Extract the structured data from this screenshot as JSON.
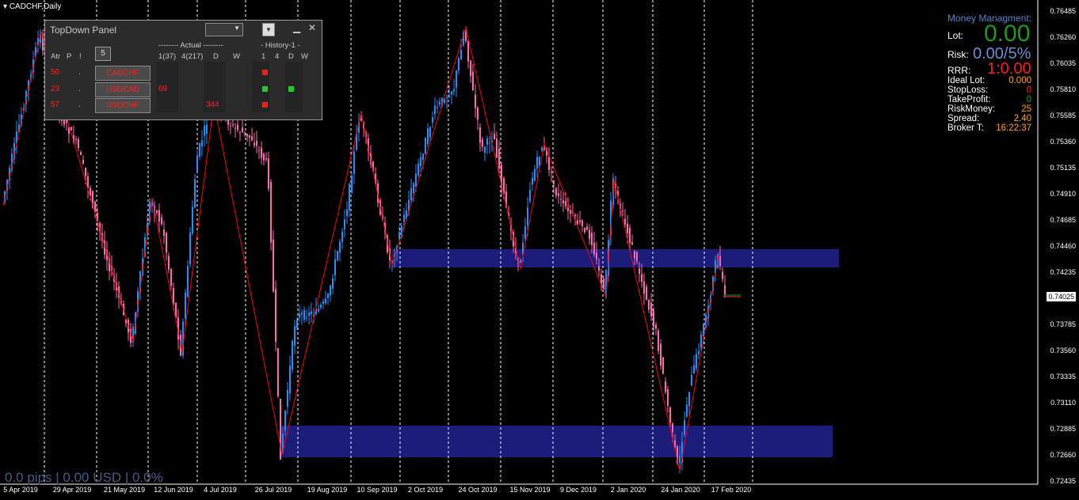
{
  "symbol_title": "CADCHF,Daily",
  "pips_text": "0.0 pips | 0.00 USD | 0.0%",
  "current_price": "0.74025",
  "price_axis": {
    "labels": [
      "0.76485",
      "0.76260",
      "0.76035",
      "0.75810",
      "0.75585",
      "0.75360",
      "0.75135",
      "0.74910",
      "0.74685",
      "0.74460",
      "0.74235",
      "0.73785",
      "0.73560",
      "0.73335",
      "0.73110",
      "0.72885",
      "0.72660",
      "0.72435"
    ]
  },
  "date_axis": {
    "labels": [
      "5 Apr 2019",
      "29 Apr 2019",
      "21 May 2019",
      "12 Jun 2019",
      "4 Jul 2019",
      "26 Jul 2019",
      "19 Aug 2019",
      "10 Sep 2019",
      "2 Oct 2019",
      "24 Oct 2019",
      "15 Nov 2019",
      "9 Dec 2019",
      "2 Jan 2020",
      "24 Jan 2020",
      "17 Feb 2020"
    ]
  },
  "colors": {
    "bull_candle": "#1e90ff",
    "bear_candle": "#ff69b4",
    "zigzag": "#ff0000",
    "zone": "#1c1c7a",
    "grid": "#ffffff"
  },
  "topdown_panel": {
    "title": "TopDown Panel",
    "dropdown_value": "",
    "headers": {
      "atr": "Atr",
      "p": "P",
      "excl": "!",
      "actual_group": "-------- Actual --------",
      "history_group": "- History-1 -",
      "h_1_37": "1(37)",
      "h_4_217": "4(217)",
      "h_d": "D",
      "h_w": "W",
      "h2_1": "1",
      "h2_4": "4",
      "h2_d": "D",
      "h2_w": "W"
    },
    "button_5": "5",
    "minimize_icon": "minimize-icon",
    "close_icon": "close-icon",
    "rows": [
      {
        "atr": "50",
        "dot": ".",
        "symbol": "CADCHF",
        "v1": "",
        "v3": ""
      },
      {
        "atr": "23",
        "dot": ".",
        "symbol": "USDCAD",
        "v1": "69",
        "v3": ""
      },
      {
        "atr": "57",
        "dot": ".",
        "symbol": "USDCHF",
        "v1": "",
        "v3": "344"
      }
    ]
  },
  "money_management": {
    "title": "Money Managment:",
    "lot_label": "Lot:",
    "lot_value": "0.00",
    "risk_label": "Risk:",
    "risk_value": "0.00/5%",
    "rrr_label": "RRR:",
    "rrr_value": "1:0.00",
    "rows": [
      {
        "key": "Ideal Lot:",
        "value": "0.000",
        "color": "#ffa500"
      },
      {
        "key": "StopLoss:",
        "value": "0",
        "color": "#ff2020"
      },
      {
        "key": "TakeProfit:",
        "value": "0",
        "color": "#1a9a1a"
      },
      {
        "key": "RiskMoney:",
        "value": "25",
        "color": "#ffa500"
      },
      {
        "key": "Spread:",
        "value": "2.40",
        "color": "#ffa500"
      },
      {
        "key": "Broker T:",
        "value": "16:22:37",
        "color": "#ffa500"
      }
    ]
  }
}
